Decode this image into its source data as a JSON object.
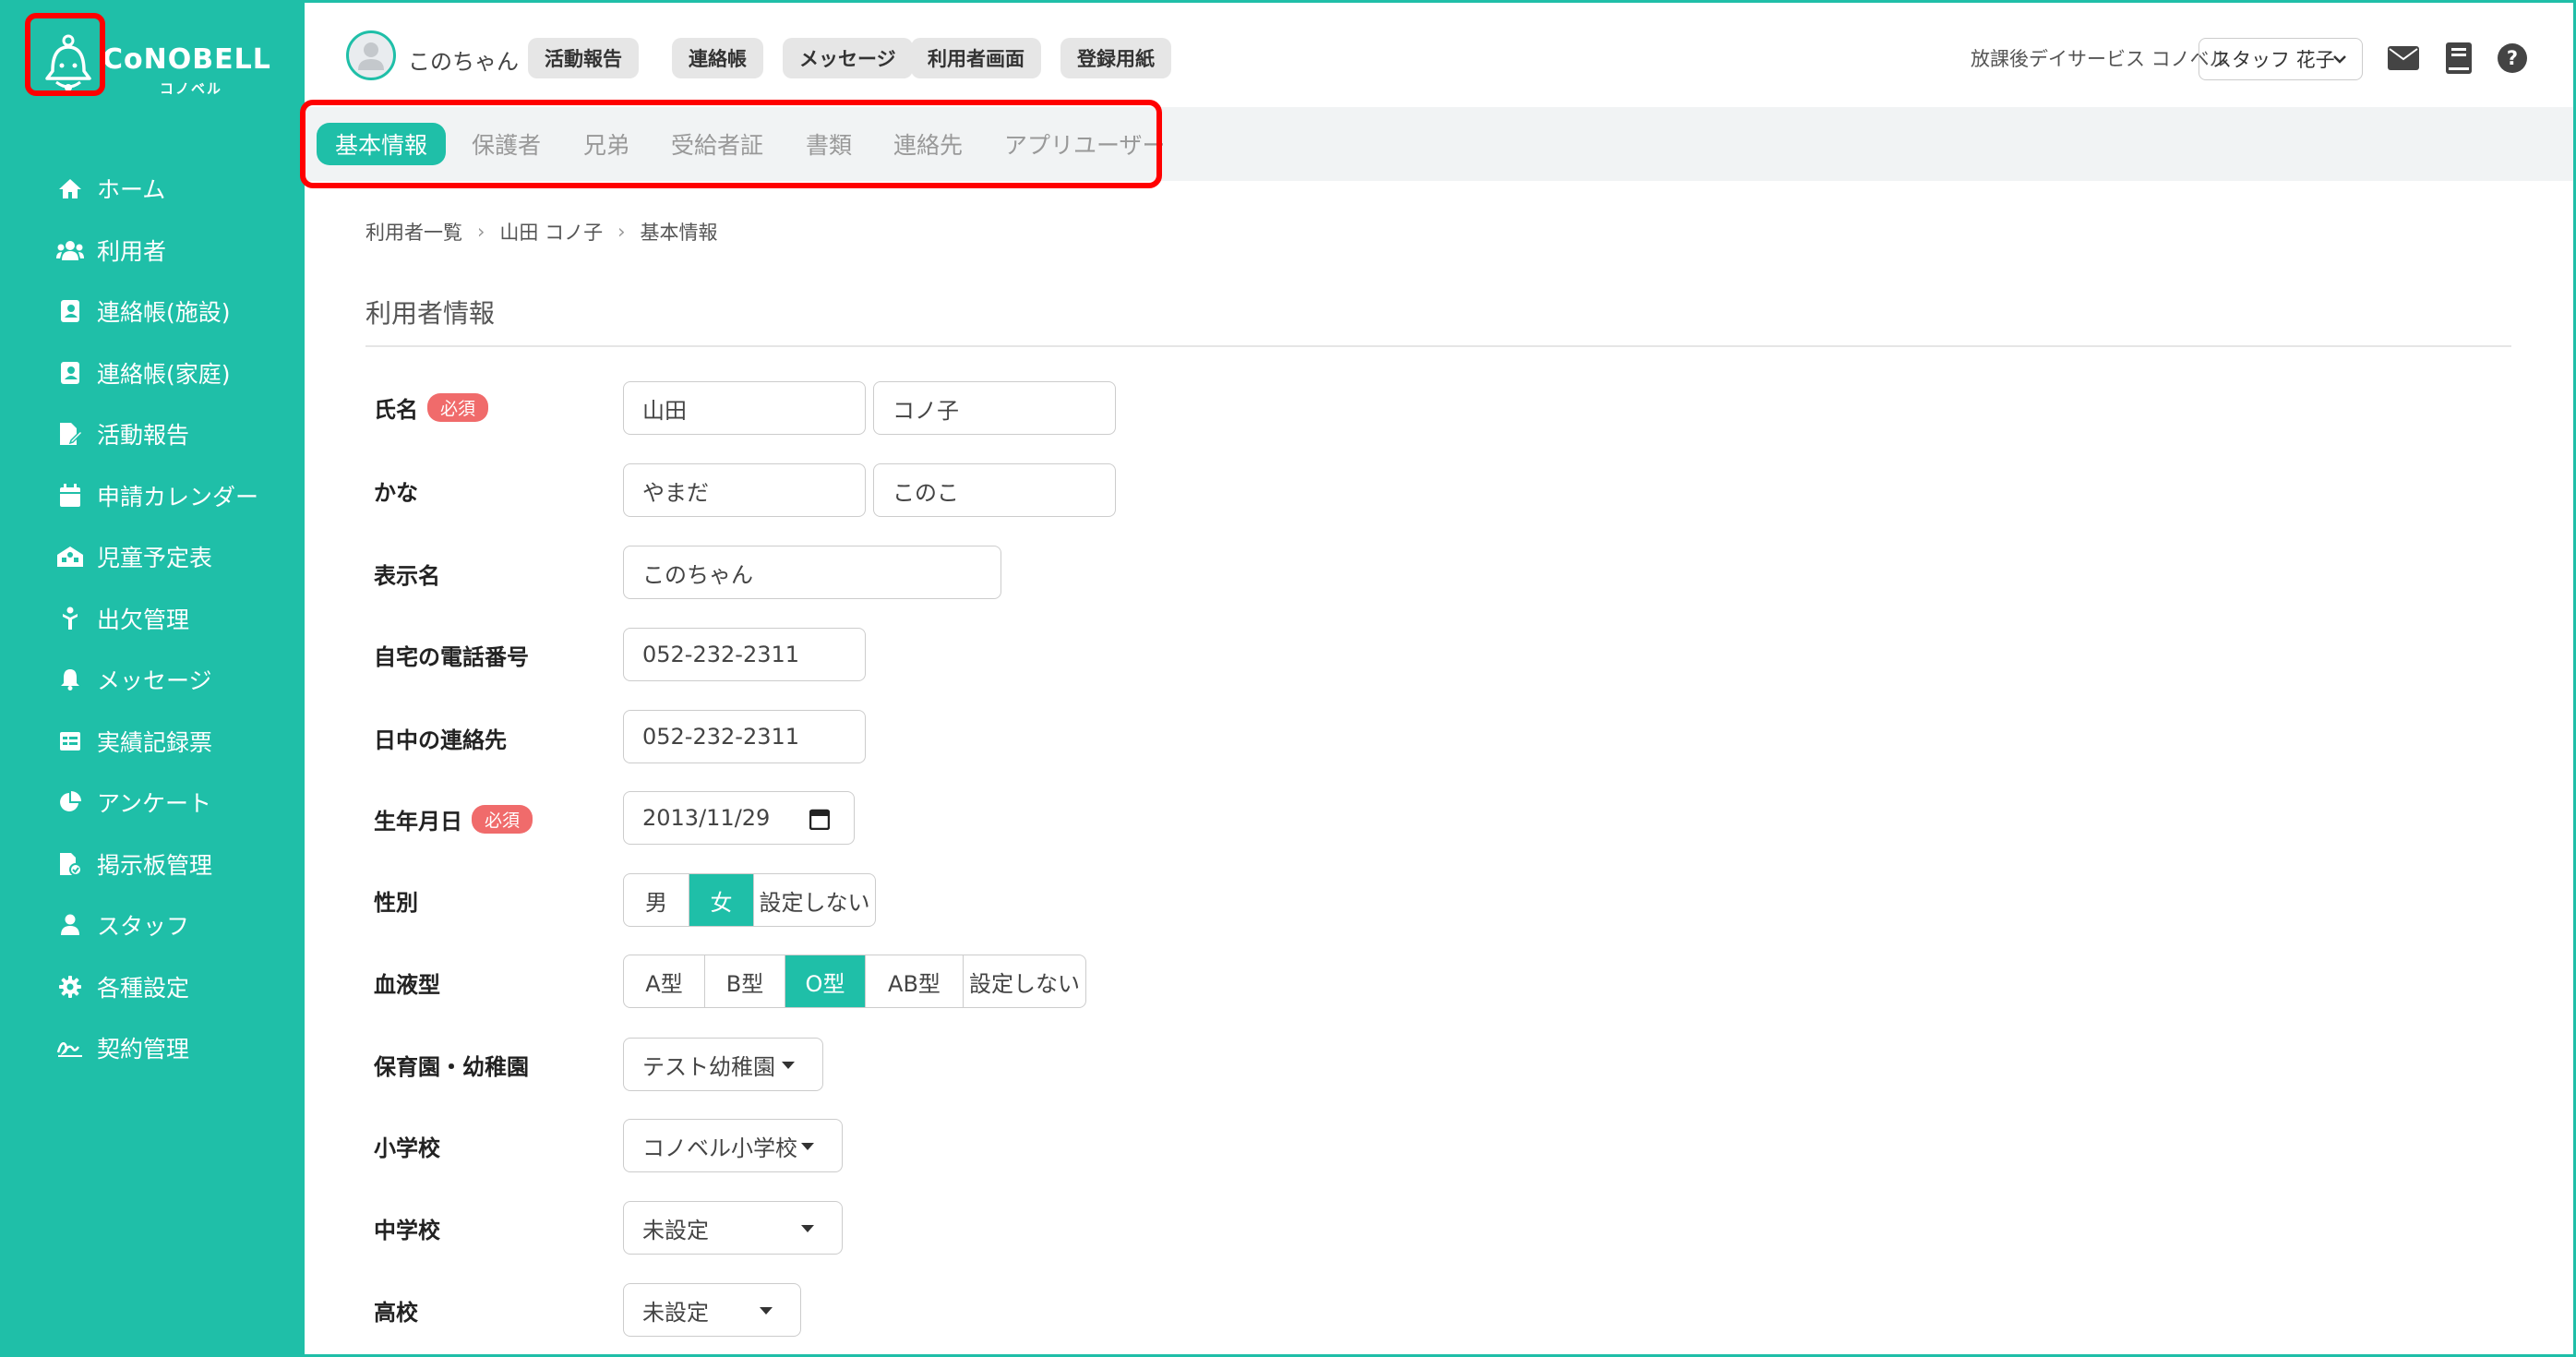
{
  "app": {
    "logo_text": "CoNOBELL",
    "logo_sub": "コノベル"
  },
  "sidebar": {
    "items": [
      {
        "label": "ホーム",
        "icon": "home-icon"
      },
      {
        "label": "利用者",
        "icon": "users-icon"
      },
      {
        "label": "連絡帳(施設)",
        "icon": "contact-book-icon"
      },
      {
        "label": "連絡帳(家庭)",
        "icon": "contact-book-icon"
      },
      {
        "label": "活動報告",
        "icon": "report-icon"
      },
      {
        "label": "申請カレンダー",
        "icon": "calendar-icon"
      },
      {
        "label": "児童予定表",
        "icon": "schedule-icon"
      },
      {
        "label": "出欠管理",
        "icon": "attendance-icon"
      },
      {
        "label": "メッセージ",
        "icon": "bell-icon"
      },
      {
        "label": "実績記録票",
        "icon": "table-icon"
      },
      {
        "label": "アンケート",
        "icon": "pie-chart-icon"
      },
      {
        "label": "掲示板管理",
        "icon": "board-icon"
      },
      {
        "label": "スタッフ",
        "icon": "staff-icon"
      },
      {
        "label": "各種設定",
        "icon": "gear-icon"
      },
      {
        "label": "契約管理",
        "icon": "signature-icon"
      }
    ]
  },
  "header": {
    "user_name": "このちゃん",
    "buttons": [
      "活動報告",
      "連絡帳",
      "メッセージ",
      "利用者画面",
      "登録用紙"
    ],
    "facility": "放課後デイサービス コノベル",
    "staff": "スタッフ 花子"
  },
  "tabs": [
    "基本情報",
    "保護者",
    "兄弟",
    "受給者証",
    "書類",
    "連絡先",
    "アプリユーザー"
  ],
  "breadcrumb": [
    "利用者一覧",
    "山田 コノ子",
    "基本情報"
  ],
  "section_title": "利用者情報",
  "form": {
    "required": "必須",
    "name_label": "氏名",
    "last_name": "山田",
    "first_name": "コノ子",
    "kana_label": "かな",
    "last_kana": "やまだ",
    "first_kana": "このこ",
    "display_label": "表示名",
    "display_name": "このちゃん",
    "home_phone_label": "自宅の電話番号",
    "home_phone": "052-232-2311",
    "day_phone_label": "日中の連絡先",
    "day_phone": "052-232-2311",
    "birth_label": "生年月日",
    "birth": "2013/11/29",
    "gender_label": "性別",
    "gender_options": [
      "男",
      "女",
      "設定しない"
    ],
    "gender_selected": 1,
    "blood_label": "血液型",
    "blood_options": [
      "A型",
      "B型",
      "O型",
      "AB型",
      "設定しない"
    ],
    "blood_selected": 2,
    "nursery_label": "保育園・幼稚園",
    "nursery": "テスト幼稚園",
    "elementary_label": "小学校",
    "elementary": "コノベル小学校",
    "junior_label": "中学校",
    "junior": "未設定",
    "high_label": "高校",
    "high": "未設定"
  },
  "colors": {
    "accent": "#1fbfa8",
    "required_badge": "#f06b6b",
    "highlight_box": "#ff0000"
  }
}
